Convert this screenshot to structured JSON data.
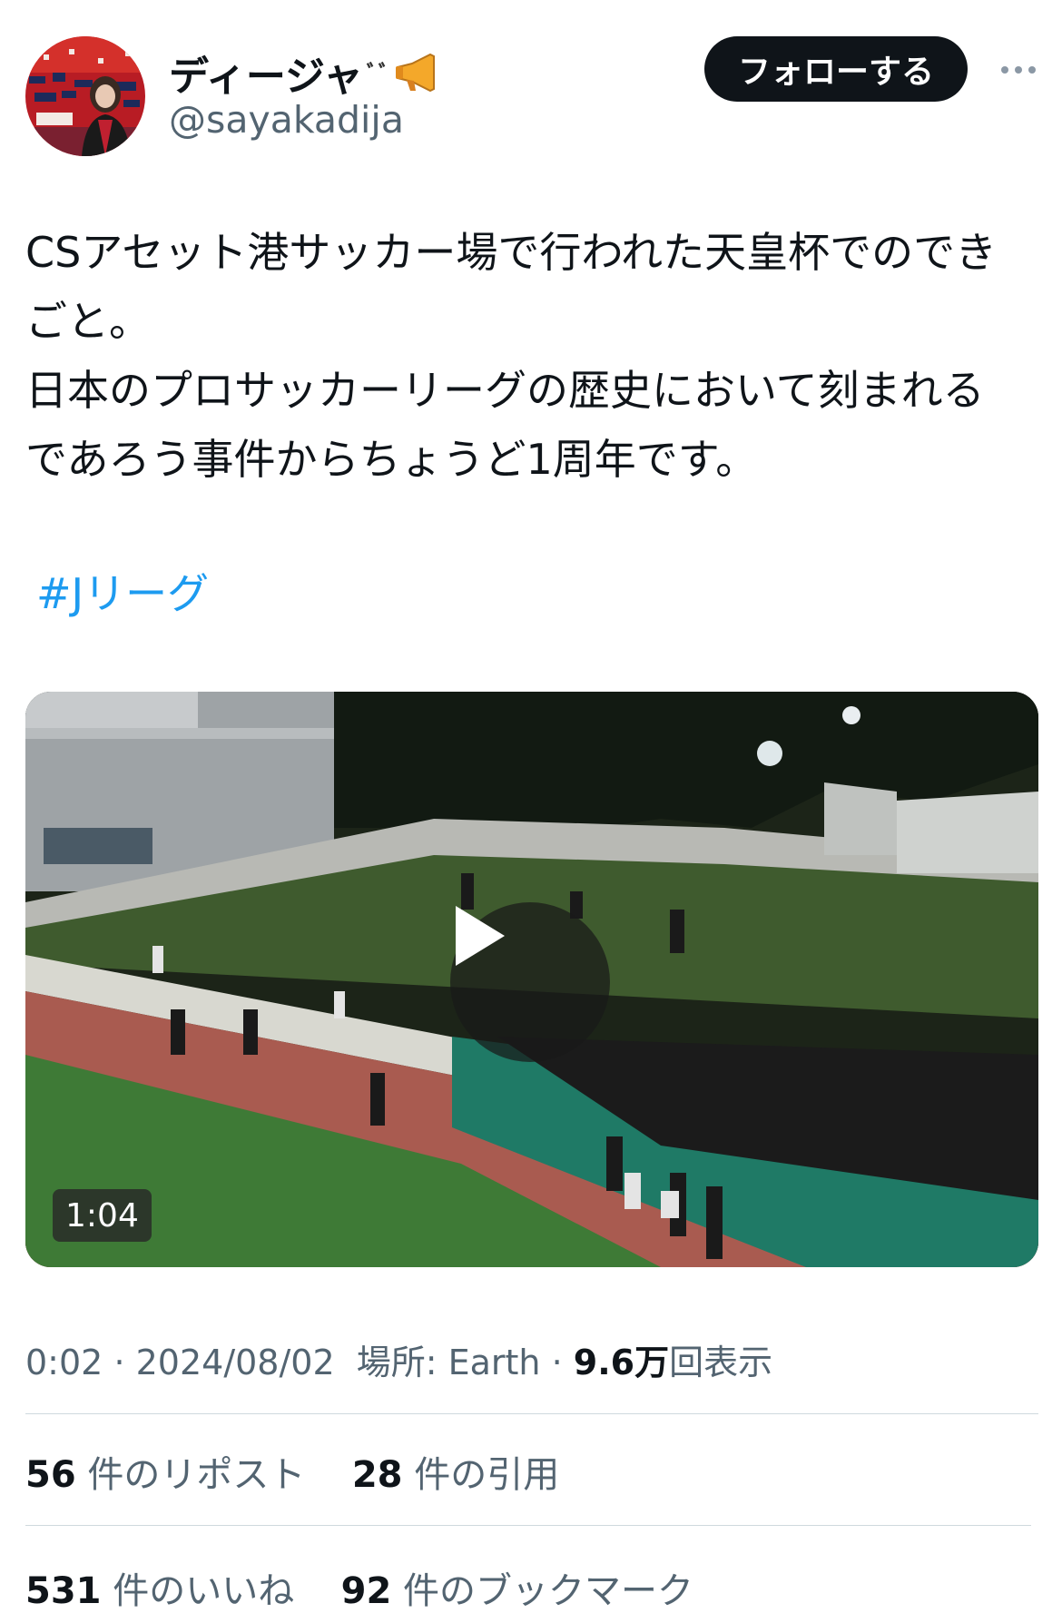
{
  "author": {
    "display_name": "ディージャ",
    "handle": "@sayakadija",
    "follow_label": "フォローする"
  },
  "tweet": {
    "lines": [
      "CSアセット港サッカー場で行われた天皇杯でのでき",
      "ごと。",
      "日本のプロサッカーリーグの歴史において刻まれる",
      "であろう事件からちょうど1周年です。"
    ],
    "hashtag": "#Jリーグ"
  },
  "media": {
    "type": "video",
    "duration": "1:04"
  },
  "meta": {
    "time": "0:02",
    "date": "2024/08/02",
    "location_label": "場所: Earth",
    "views_value": "9.6万",
    "views_label": "回表示"
  },
  "stats": {
    "reposts_value": "56",
    "reposts_label": "件のリポスト",
    "quotes_value": "28",
    "quotes_label": "件の引用",
    "likes_value": "531",
    "likes_label": "件のいいね",
    "bookmarks_value": "92",
    "bookmarks_label": "件のブックマーク"
  },
  "colors": {
    "link": "#1d9bf0",
    "secondary_text": "#536471",
    "primary_text": "#0f1419",
    "button_bg": "#0f1419"
  },
  "icons": [
    "megaphone-icon",
    "play-icon",
    "more-icon"
  ]
}
